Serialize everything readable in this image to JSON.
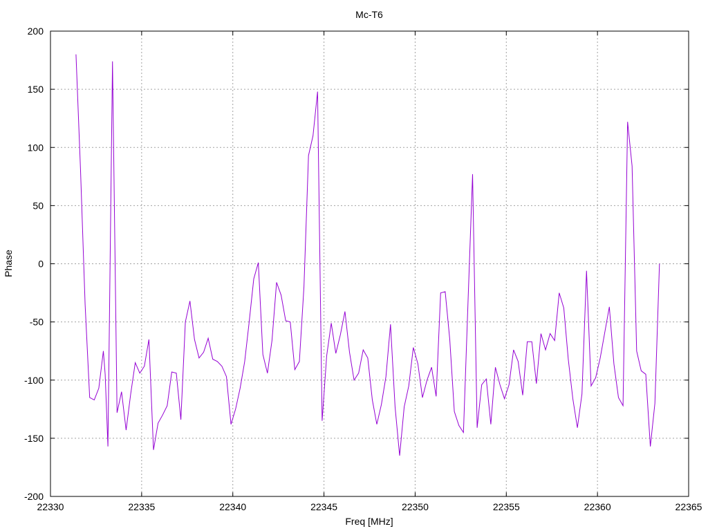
{
  "chart_data": {
    "type": "line",
    "title": "Mc-T6",
    "xlabel": "Freq [MHz]",
    "ylabel": "Phase",
    "xlim": [
      22330,
      22365
    ],
    "ylim": [
      -200,
      200
    ],
    "xticks": [
      22330,
      22335,
      22340,
      22345,
      22350,
      22355,
      22360,
      22365
    ],
    "yticks": [
      -200,
      -150,
      -100,
      -50,
      0,
      50,
      100,
      150,
      200
    ],
    "grid": true,
    "line_color": "#9400d3",
    "series": [
      {
        "x": [
          22331.4,
          22331.65,
          22331.9,
          22332.15,
          22332.4,
          22332.65,
          22332.9,
          22333.0,
          22333.15,
          22333.4,
          22333.65,
          22333.9,
          22334.15,
          22334.4,
          22334.65,
          22334.9,
          22335.15,
          22335.4,
          22335.65,
          22335.9,
          22336.15,
          22336.4,
          22336.65,
          22336.9,
          22337.15,
          22337.4,
          22337.65,
          22337.9,
          22338.15,
          22338.4,
          22338.65,
          22338.9,
          22339.15,
          22339.4,
          22339.65,
          22339.9,
          22340.15,
          22340.4,
          22340.65,
          22340.9,
          22341.15,
          22341.4,
          22341.65,
          22341.9,
          22342.15,
          22342.4,
          22342.65,
          22342.9,
          22343.15,
          22343.4,
          22343.65,
          22343.9,
          22344.15,
          22344.4,
          22344.65,
          22344.9,
          22345.15,
          22345.4,
          22345.65,
          22345.9,
          22346.15,
          22346.4,
          22346.65,
          22346.9,
          22347.15,
          22347.4,
          22347.65,
          22347.9,
          22348.15,
          22348.4,
          22348.65,
          22348.9,
          22349.15,
          22349.4,
          22349.65,
          22349.9,
          22350.15,
          22350.4,
          22350.65,
          22350.9,
          22351.15,
          22351.4,
          22351.65,
          22351.9,
          22352.15,
          22352.4,
          22352.65,
          22352.9,
          22353.15,
          22353.4,
          22353.65,
          22353.9,
          22354.15,
          22354.4,
          22354.65,
          22354.9,
          22355.15,
          22355.4,
          22355.65,
          22355.9,
          22356.15,
          22356.4,
          22356.65,
          22356.9,
          22357.15,
          22357.4,
          22357.65,
          22357.9,
          22358.15,
          22358.4,
          22358.65,
          22358.9,
          22359.15,
          22359.4,
          22359.65,
          22359.9,
          22360.15,
          22360.4,
          22360.65,
          22360.9,
          22361.15,
          22361.4,
          22361.65,
          22361.9,
          22362.15,
          22362.4,
          22362.65,
          22362.9,
          22363.15,
          22363.4
        ],
        "y": [
          180,
          80,
          -35,
          -115,
          -117,
          -107,
          -75,
          -95,
          -157,
          174,
          -128,
          -110,
          -143,
          -112,
          -85,
          -94,
          -88,
          -65,
          -160,
          -137,
          -130,
          -122,
          -93,
          -94,
          -134,
          -50,
          -32,
          -65,
          -81,
          -76,
          -64,
          -82,
          -84,
          -88,
          -97,
          -138,
          -125,
          -107,
          -84,
          -50,
          -13,
          1,
          -78,
          -94,
          -66,
          -16,
          -27,
          -49,
          -50,
          -91,
          -84,
          -20,
          93,
          110,
          148,
          -135,
          -79,
          -51,
          -77,
          -61,
          -41,
          -76,
          -100,
          -94,
          -74,
          -81,
          -117,
          -138,
          -121,
          -97,
          -52,
          -123,
          -165,
          -123,
          -105,
          -72,
          -86,
          -115,
          -100,
          -89,
          -114,
          -25,
          -24,
          -65,
          -127,
          -139,
          -145,
          -33,
          77,
          -141,
          -104,
          -99,
          -138,
          -89,
          -104,
          -116,
          -104,
          -74,
          -84,
          -113,
          -67,
          -67,
          -103,
          -60,
          -74,
          -60,
          -66,
          -25,
          -38,
          -82,
          -116,
          -141,
          -112,
          -6,
          -105,
          -98,
          -81,
          -59,
          -37,
          -86,
          -115,
          -122,
          122,
          84,
          -75,
          -92,
          -95,
          -157,
          -120,
          0
        ]
      }
    ]
  }
}
